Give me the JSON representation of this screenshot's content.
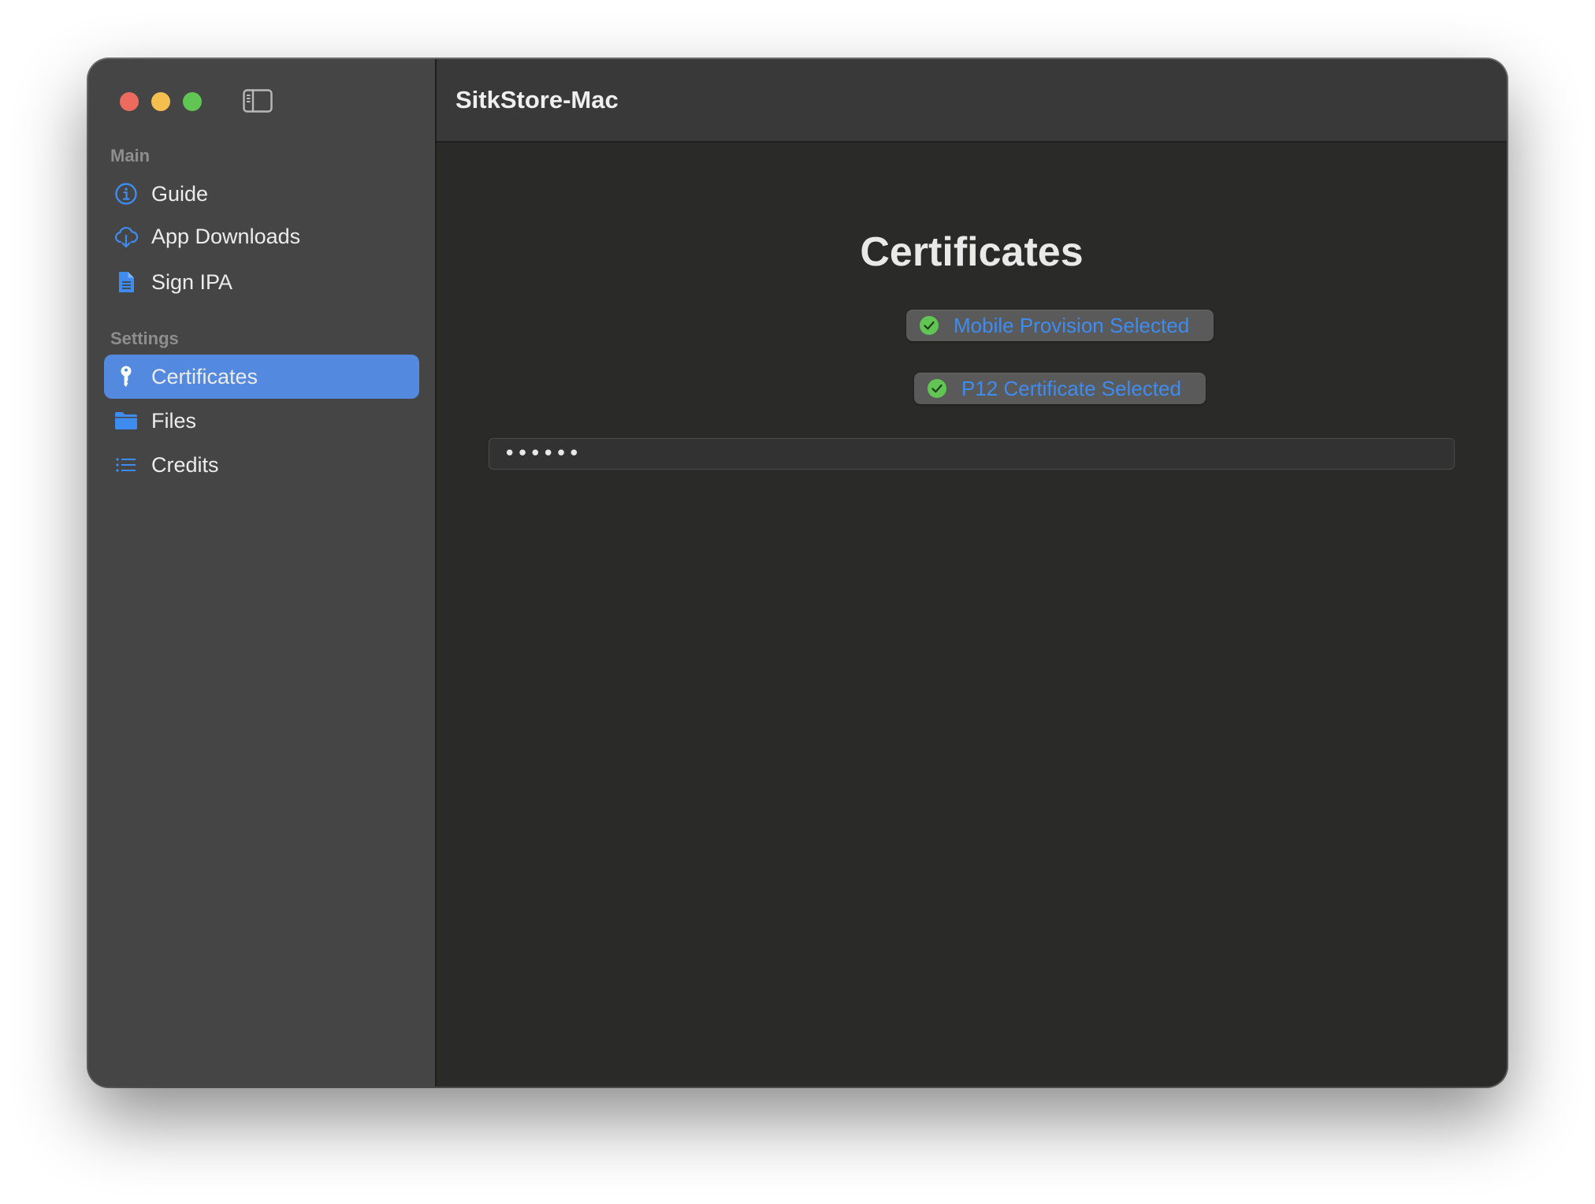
{
  "window": {
    "title": "SitkStore-Mac"
  },
  "sidebar": {
    "sections": [
      {
        "label": "Main",
        "items": [
          {
            "label": "Guide",
            "icon": "info-circle-icon"
          },
          {
            "label": "App Downloads",
            "icon": "cloud-download-icon"
          },
          {
            "label": "Sign IPA",
            "icon": "document-icon"
          }
        ]
      },
      {
        "label": "Settings",
        "items": [
          {
            "label": "Certificates",
            "icon": "key-icon",
            "selected": true
          },
          {
            "label": "Files",
            "icon": "folder-icon"
          },
          {
            "label": "Credits",
            "icon": "list-icon"
          }
        ]
      }
    ]
  },
  "main": {
    "heading": "Certificates",
    "provision_status": "Mobile Provision Selected",
    "p12_status": "P12 Certificate Selected",
    "password_value": "••••••"
  },
  "colors": {
    "accent": "#5489e0",
    "link_blue": "#3f8cf1",
    "check_green": "#61c554",
    "sidebar_bg": "#454545",
    "content_bg": "#2a2a29"
  }
}
